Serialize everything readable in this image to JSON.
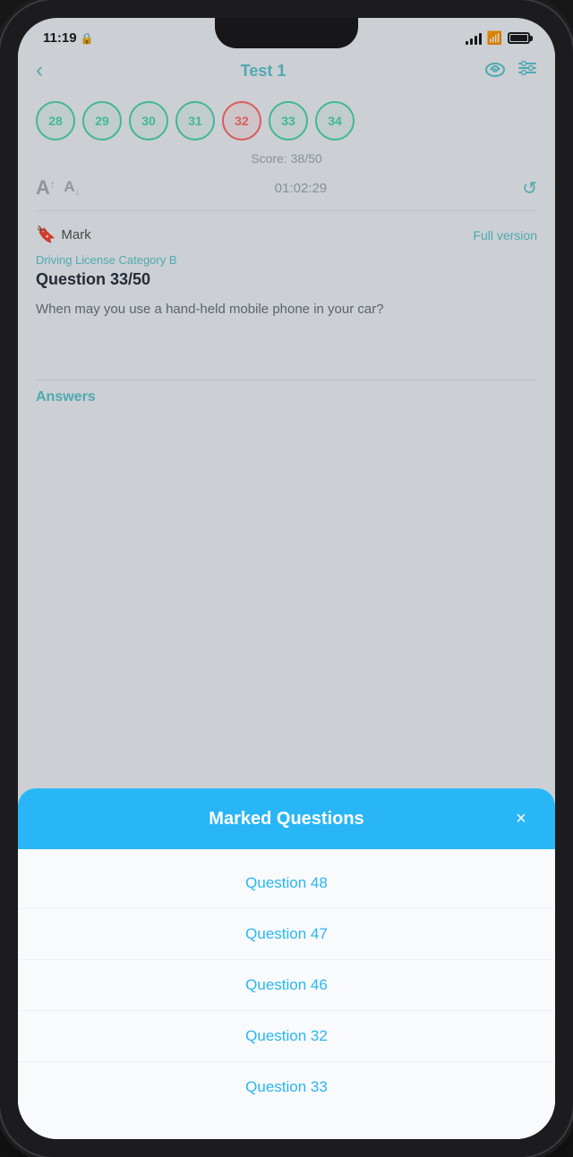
{
  "statusBar": {
    "time": "11:19",
    "signalBars": [
      4,
      7,
      10,
      13
    ],
    "batteryPercent": 90
  },
  "header": {
    "backLabel": "‹",
    "title": "Test 1",
    "cloudIconLabel": "☁",
    "filterIconLabel": "⚙"
  },
  "questionNumbers": [
    {
      "number": "28",
      "status": "green"
    },
    {
      "number": "29",
      "status": "green"
    },
    {
      "number": "30",
      "status": "green"
    },
    {
      "number": "31",
      "status": "green"
    },
    {
      "number": "32",
      "status": "red"
    },
    {
      "number": "33",
      "status": "green"
    },
    {
      "number": "34",
      "status": "green"
    }
  ],
  "score": "Score: 38/50",
  "timer": "01:02:29",
  "controls": {
    "fontUpLabel": "A",
    "fontDownLabel": "A",
    "refreshLabel": "↺"
  },
  "question": {
    "markLabel": "Mark",
    "fullVersionLabel": "Full version",
    "category": "Driving License Category B",
    "title": "Question 33/50",
    "text": "When may you use a hand-held mobile phone in your car?"
  },
  "answersLabel": "Answers",
  "modal": {
    "title": "Marked Questions",
    "closeLabel": "×",
    "items": [
      "Question 48",
      "Question 47",
      "Question 46",
      "Question 32",
      "Question 33"
    ]
  }
}
